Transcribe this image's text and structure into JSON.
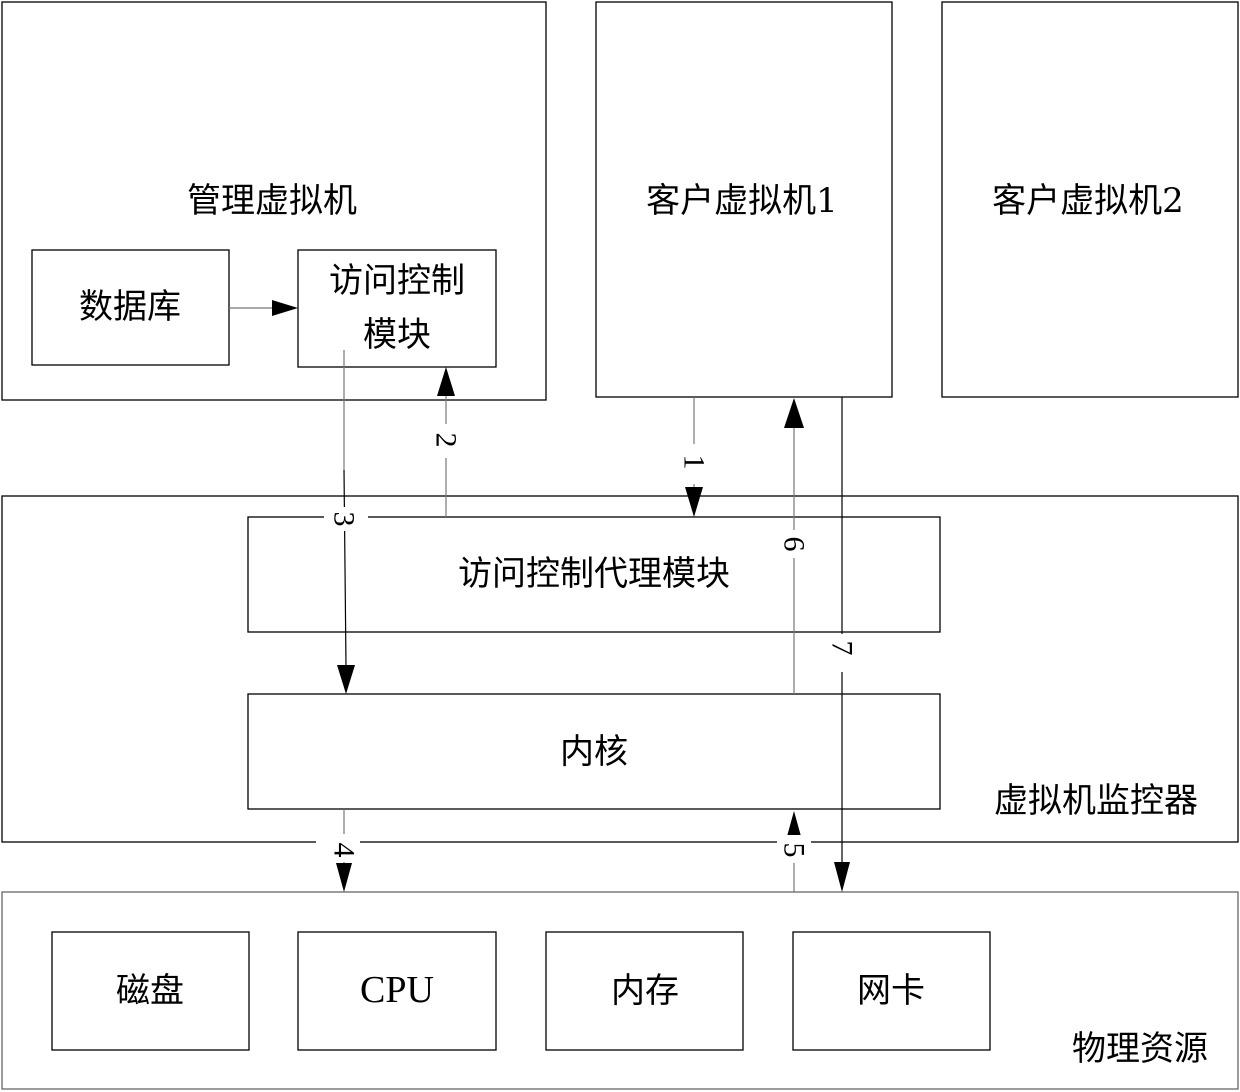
{
  "diagram": {
    "management_vm": {
      "title": "管理虚拟机",
      "database": "数据库",
      "access_control_module_line1": "访问控制",
      "access_control_module_line2": "模块"
    },
    "guest_vm_1": "客户虚拟机1",
    "guest_vm_2": "客户虚拟机2",
    "hypervisor": {
      "title": "虚拟机监控器",
      "agent_module": "访问控制代理模块",
      "kernel": "内核"
    },
    "physical_resources": {
      "title": "物理资源",
      "items": [
        "磁盘",
        "CPU",
        "内存",
        "网卡"
      ]
    },
    "edges": [
      {
        "label": "1",
        "from": "客户虚拟机1",
        "to": "访问控制代理模块"
      },
      {
        "label": "2",
        "from": "访问控制代理模块",
        "to": "访问控制模块"
      },
      {
        "label": "3",
        "from": "访问控制模块",
        "to": "内核"
      },
      {
        "label": "4",
        "from": "内核",
        "to": "物理资源"
      },
      {
        "label": "5",
        "from": "物理资源",
        "to": "内核"
      },
      {
        "label": "6",
        "from": "内核",
        "to": "客户虚拟机1"
      },
      {
        "label": "7",
        "from": "客户虚拟机1",
        "to": "网卡"
      },
      {
        "label": "",
        "from": "数据库",
        "to": "访问控制模块"
      }
    ]
  }
}
